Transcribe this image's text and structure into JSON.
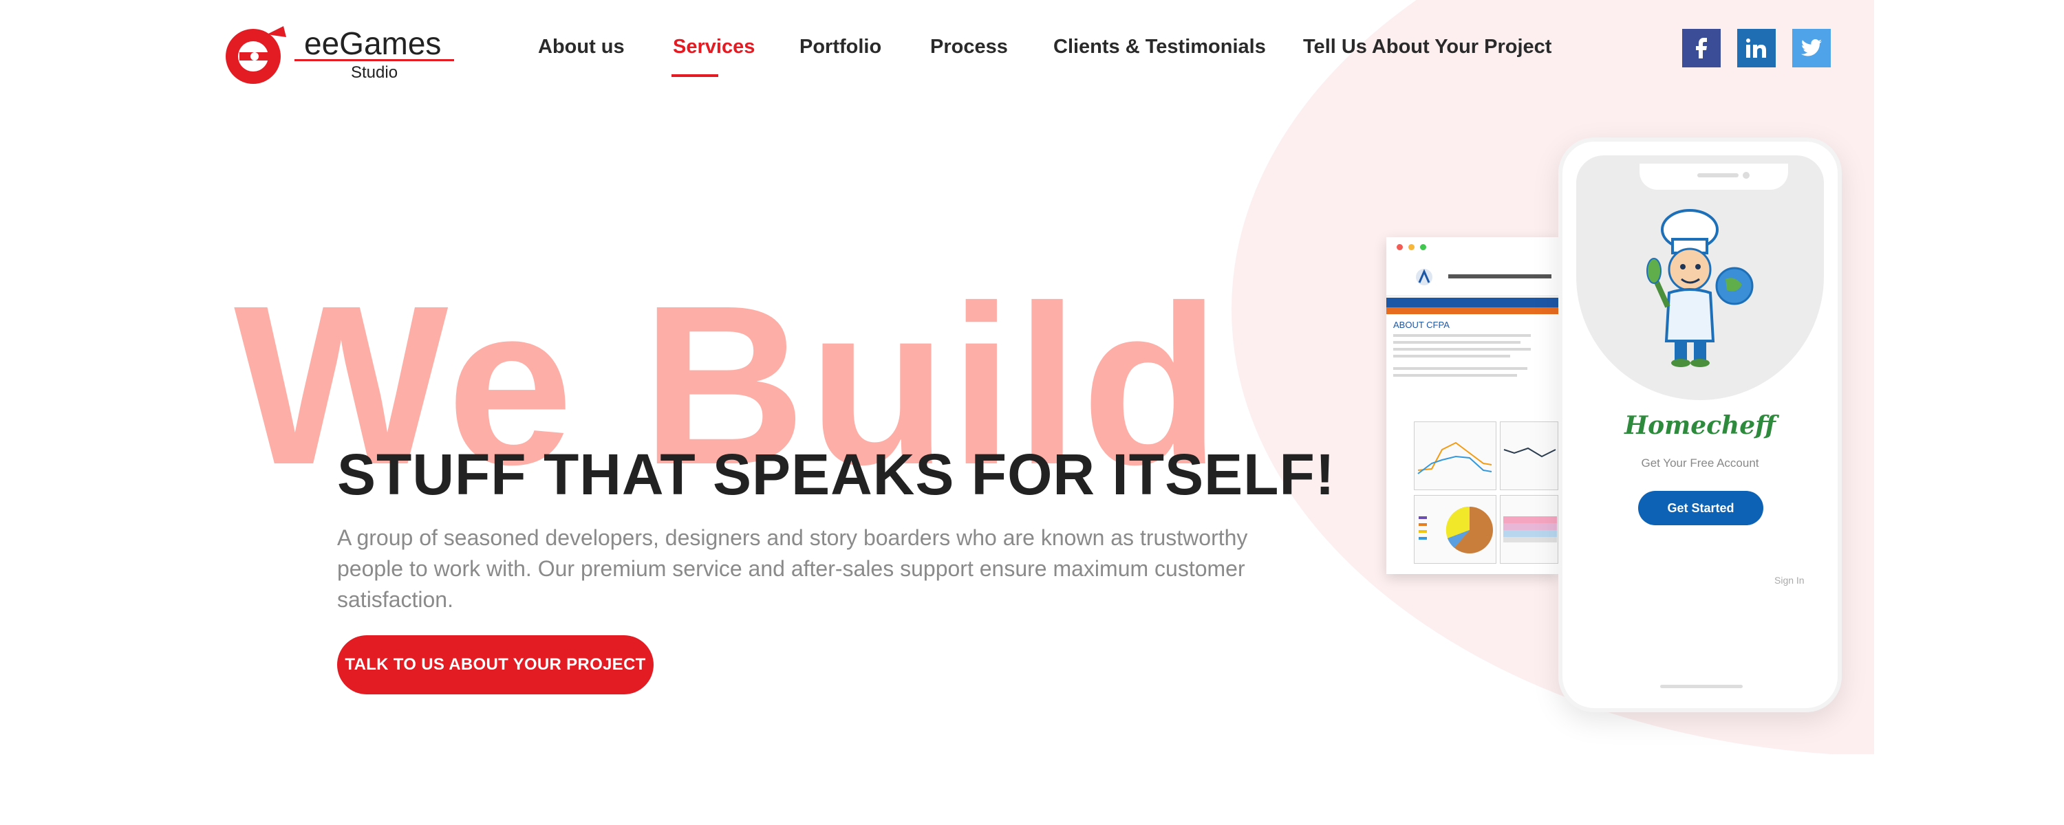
{
  "header": {
    "logo": {
      "title": "eeGames",
      "subtitle": "Studio"
    },
    "nav": [
      {
        "label": "About us"
      },
      {
        "label": "Services",
        "active": true
      },
      {
        "label": "Portfolio"
      },
      {
        "label": "Process"
      },
      {
        "label": "Clients & Testimonials"
      },
      {
        "label": "Tell Us About Your Project"
      }
    ],
    "social": [
      {
        "icon": "facebook-icon",
        "glyph": "f",
        "color": "#3b4d96"
      },
      {
        "icon": "linkedin-icon",
        "glyph": "in",
        "color": "#1f6db2"
      },
      {
        "icon": "twitter-icon",
        "glyph": "t",
        "color": "#4fa3e8"
      }
    ]
  },
  "hero": {
    "big_word": "We Build",
    "headline": "STUFF THAT SPEAKS FOR ITSELF!",
    "description": "A group of seasoned developers, designers and story boarders who are known as trustworthy people to work with. Our premium service and after-sales support ensure maximum customer satisfaction.",
    "cta_label": "TALK TO US ABOUT YOUR PROJECT"
  },
  "phone": {
    "brand": "Homecheff",
    "subtitle": "Get Your Free Account",
    "button": "Get Started",
    "signin": "Sign In"
  },
  "dashboard": {
    "heading": "ABOUT CFPA"
  },
  "colors": {
    "accent": "#e31b23",
    "big_word": "#fd6d5e",
    "background_arc": "#fdefef",
    "phone_button": "#0d62b5"
  }
}
